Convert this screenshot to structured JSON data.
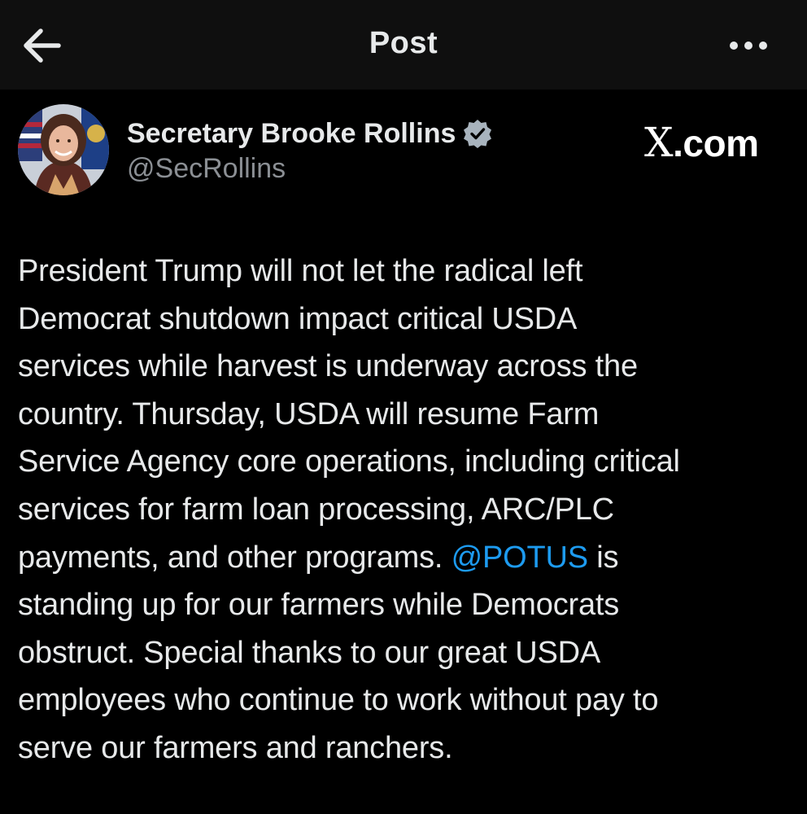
{
  "header": {
    "title": "Post",
    "back_icon": "arrow-left-icon",
    "more_icon": "more-horizontal-icon"
  },
  "author": {
    "name": "Secretary Brooke Rollins",
    "handle": "@SecRollins",
    "verified_icon": "verified-badge-icon",
    "verified_color": "#a8b3bd"
  },
  "watermark": {
    "x": "X",
    "domain": ".com"
  },
  "post": {
    "text_before": "President Trump will not let the radical left\nDemocrat shutdown impact critical USDA\nservices while harvest is underway across the\ncountry. Thursday, USDA will resume Farm\nService Agency core operations, including critical\nservices for farm loan processing, ARC/PLC\npayments, and other programs. ",
    "mention": "@POTUS",
    "text_after": " is\nstanding up for our farmers while Democrats\nobstruct. Special thanks to our great USDA\nemployees who continue to work without pay to\nserve our farmers and ranchers."
  },
  "colors": {
    "background": "#000000",
    "header_bg": "#0f0f0f",
    "text": "#e7e9ea",
    "secondary_text": "#8b8f94",
    "link": "#1d9bf0"
  }
}
